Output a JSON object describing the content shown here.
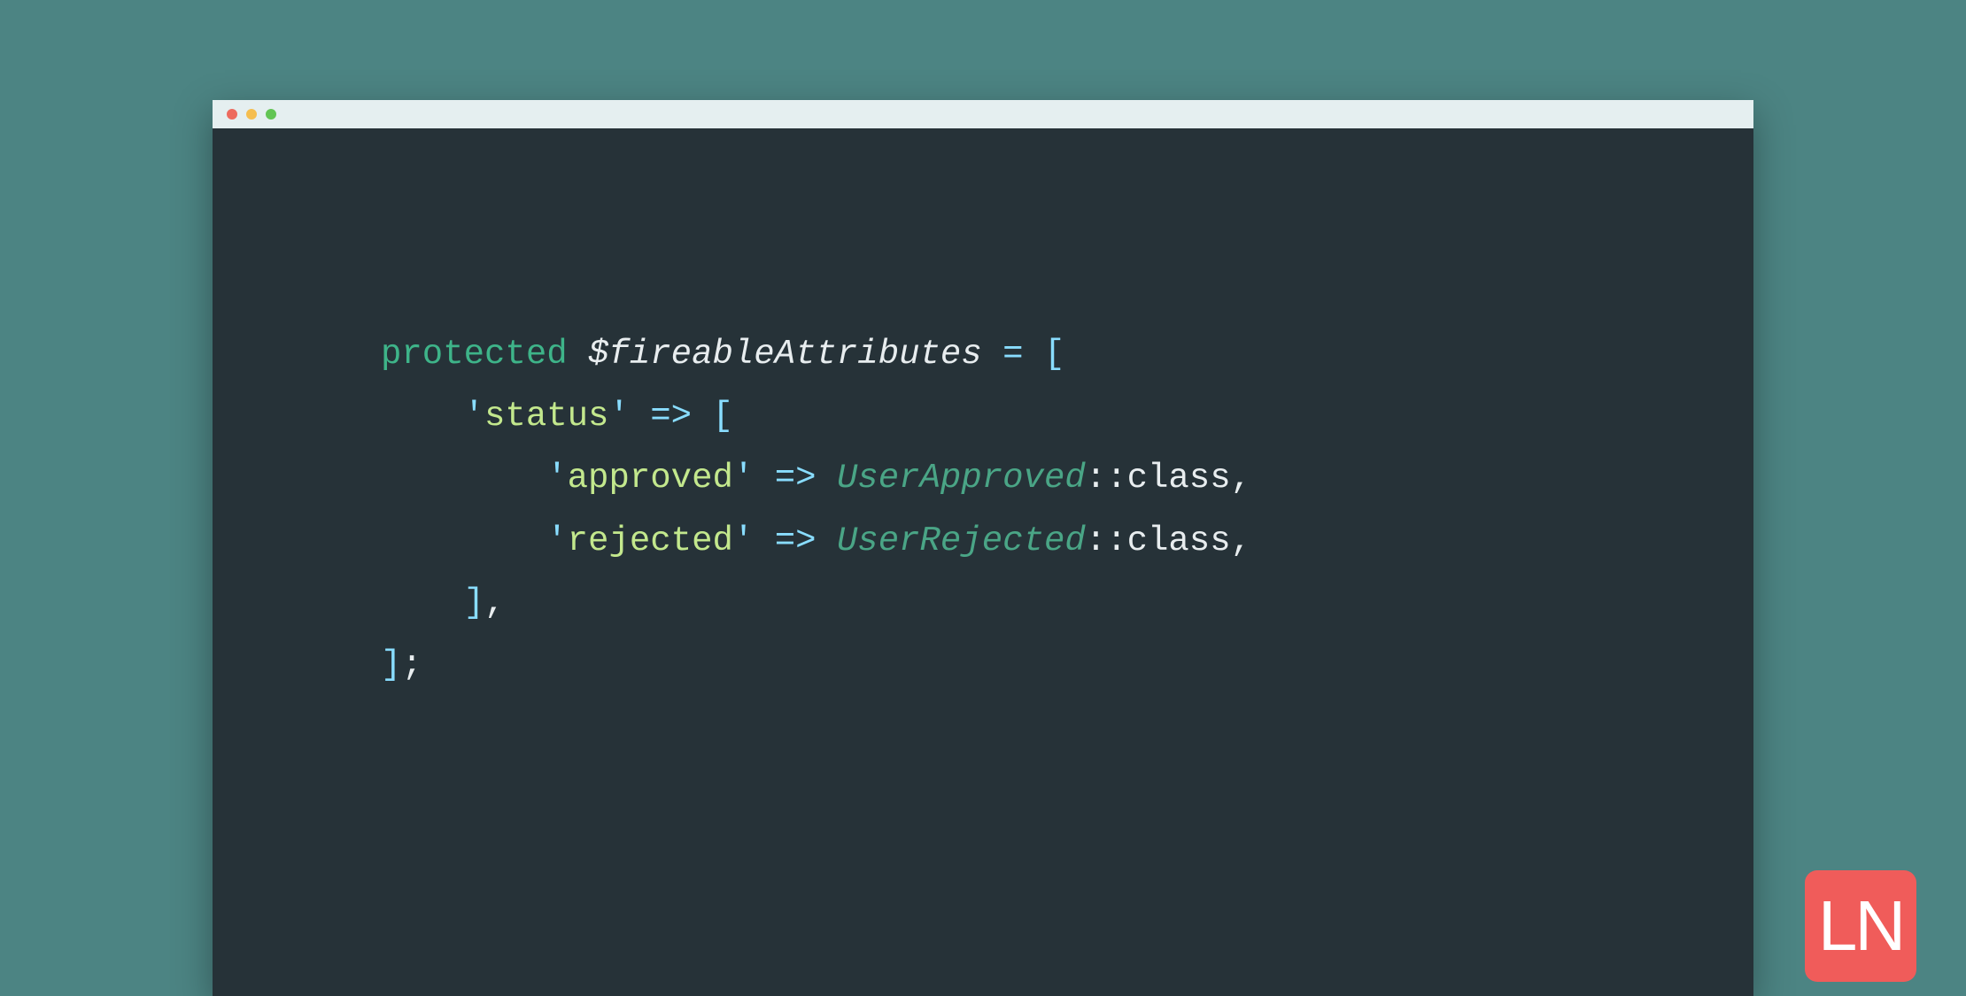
{
  "code": {
    "line1": {
      "keyword": "protected",
      "variable": "$fireableAttributes",
      "equals": "=",
      "open_bracket": "["
    },
    "line2": {
      "indent": "    ",
      "q1": "'",
      "key": "status",
      "q2": "'",
      "arrow": "=>",
      "open_bracket": "["
    },
    "line3": {
      "indent": "        ",
      "q1": "'",
      "key": "approved",
      "q2": "'",
      "arrow": "=>",
      "class_italic": "UserApproved",
      "scope": "::",
      "class_word": "class",
      "comma": ","
    },
    "line4": {
      "indent": "        ",
      "q1": "'",
      "key": "rejected",
      "q2": "'",
      "arrow": "=>",
      "class_italic": "UserRejected",
      "scope": "::",
      "class_word": "class",
      "comma": ","
    },
    "line5": {
      "indent": "    ",
      "close_bracket": "]",
      "comma": ","
    },
    "line6": {
      "close_bracket": "]",
      "semicolon": ";"
    }
  },
  "logo": {
    "text": "LN"
  }
}
